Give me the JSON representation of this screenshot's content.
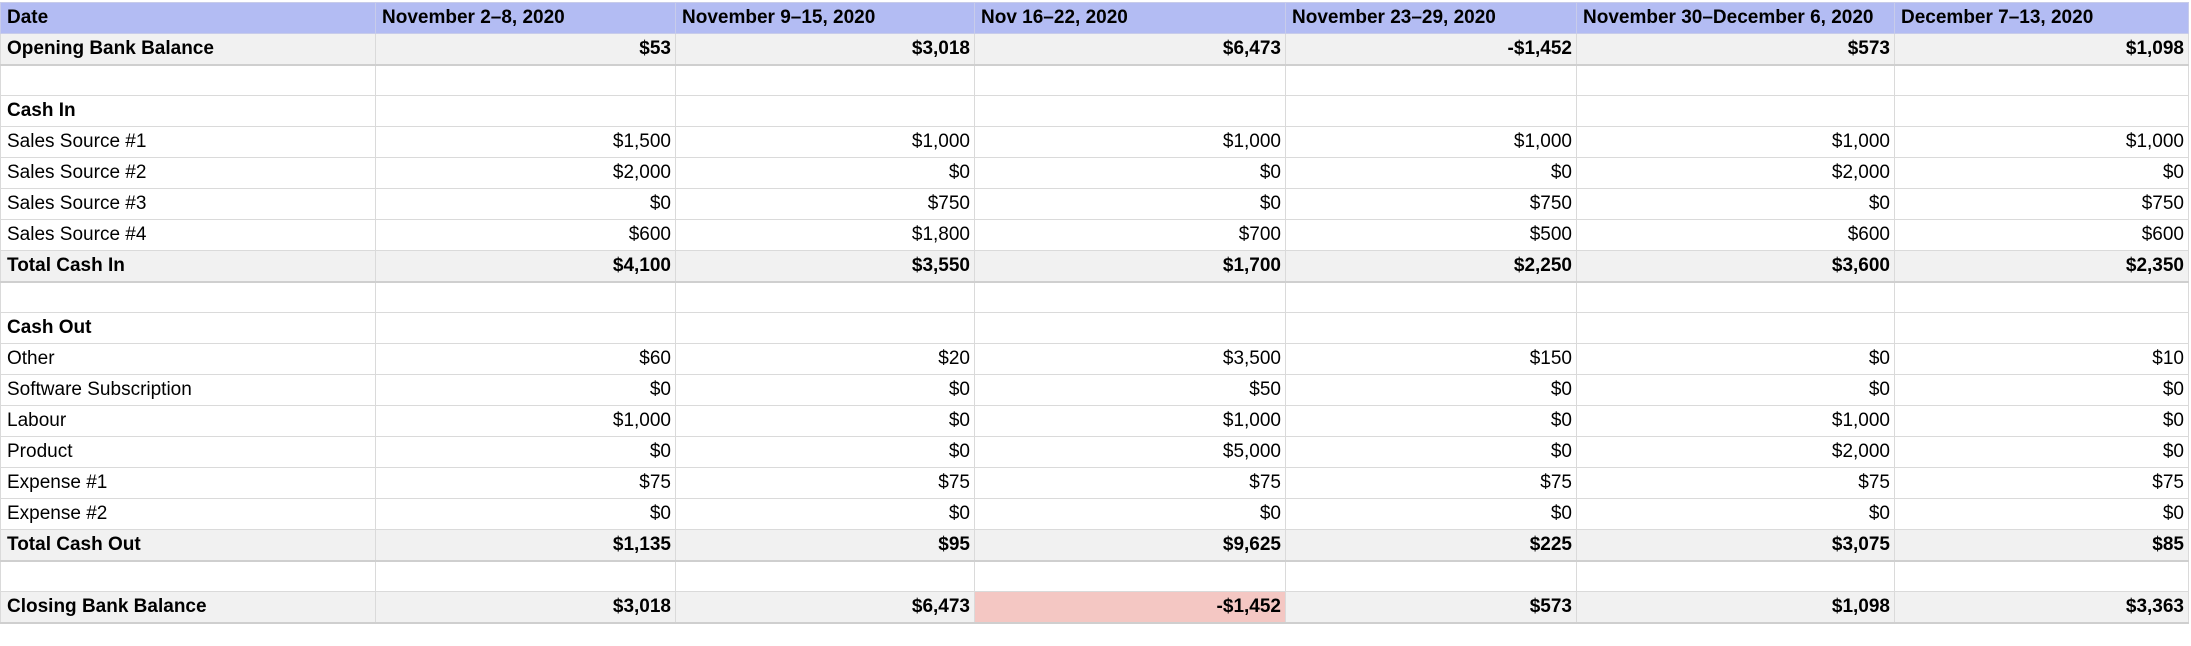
{
  "header": {
    "label": "Date",
    "periods": [
      "November 2–8, 2020",
      "November 9–15, 2020",
      "Nov 16–22, 2020",
      "November 23–29, 2020",
      "November 30–December 6, 2020",
      "December 7–13, 2020"
    ]
  },
  "rows": [
    {
      "label": "Opening Bank Balance",
      "type": "total",
      "values": [
        "$53",
        "$3,018",
        "$6,473",
        "-$1,452",
        "$573",
        "$1,098"
      ]
    },
    {
      "label": "",
      "type": "blank",
      "values": [
        "",
        "",
        "",
        "",
        "",
        ""
      ]
    },
    {
      "label": "Cash In",
      "type": "section",
      "values": [
        "",
        "",
        "",
        "",
        "",
        ""
      ]
    },
    {
      "label": "Sales Source #1",
      "type": "item",
      "values": [
        "$1,500",
        "$1,000",
        "$1,000",
        "$1,000",
        "$1,000",
        "$1,000"
      ]
    },
    {
      "label": "Sales Source #2",
      "type": "item",
      "values": [
        "$2,000",
        "$0",
        "$0",
        "$0",
        "$2,000",
        "$0"
      ]
    },
    {
      "label": "Sales Source #3",
      "type": "item",
      "values": [
        "$0",
        "$750",
        "$0",
        "$750",
        "$0",
        "$750"
      ]
    },
    {
      "label": "Sales Source #4",
      "type": "item",
      "values": [
        "$600",
        "$1,800",
        "$700",
        "$500",
        "$600",
        "$600"
      ]
    },
    {
      "label": "Total Cash In",
      "type": "total",
      "values": [
        "$4,100",
        "$3,550",
        "$1,700",
        "$2,250",
        "$3,600",
        "$2,350"
      ]
    },
    {
      "label": "",
      "type": "blank",
      "values": [
        "",
        "",
        "",
        "",
        "",
        ""
      ]
    },
    {
      "label": "Cash Out",
      "type": "section",
      "values": [
        "",
        "",
        "",
        "",
        "",
        ""
      ]
    },
    {
      "label": "Other",
      "type": "item",
      "values": [
        "$60",
        "$20",
        "$3,500",
        "$150",
        "$0",
        "$10"
      ]
    },
    {
      "label": "Software Subscription",
      "type": "item",
      "values": [
        "$0",
        "$0",
        "$50",
        "$0",
        "$0",
        "$0"
      ]
    },
    {
      "label": "Labour",
      "type": "item",
      "values": [
        "$1,000",
        "$0",
        "$1,000",
        "$0",
        "$1,000",
        "$0"
      ]
    },
    {
      "label": "Product",
      "type": "item",
      "values": [
        "$0",
        "$0",
        "$5,000",
        "$0",
        "$2,000",
        "$0"
      ]
    },
    {
      "label": "Expense #1",
      "type": "item",
      "values": [
        "$75",
        "$75",
        "$75",
        "$75",
        "$75",
        "$75"
      ]
    },
    {
      "label": "Expense #2",
      "type": "item",
      "values": [
        "$0",
        "$0",
        "$0",
        "$0",
        "$0",
        "$0"
      ]
    },
    {
      "label": "Total Cash Out",
      "type": "total",
      "values": [
        "$1,135",
        "$95",
        "$9,625",
        "$225",
        "$3,075",
        "$85"
      ]
    },
    {
      "label": "",
      "type": "blank",
      "values": [
        "",
        "",
        "",
        "",
        "",
        ""
      ]
    },
    {
      "label": "Closing Bank Balance",
      "type": "total",
      "values": [
        "$3,018",
        "$6,473",
        "-$1,452",
        "$573",
        "$1,098",
        "$3,363"
      ],
      "highlight_negative": true
    }
  ],
  "colors": {
    "header_bg": "#b3bcf3",
    "total_bg": "#f1f1f1",
    "negative_highlight": "#f4c7c3"
  }
}
